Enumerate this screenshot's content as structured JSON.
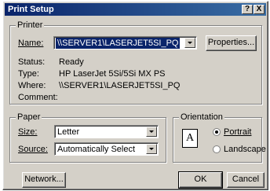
{
  "window": {
    "title": "Print Setup",
    "help_btn": "?",
    "close_btn": "X"
  },
  "printer": {
    "group_label": "Printer",
    "name_label": "Name:",
    "name_value": "\\\\SERVER1\\LASERJET5SI_PQ",
    "properties_button": "Properties...",
    "status_label": "Status:",
    "status_value": "Ready",
    "type_label": "Type:",
    "type_value": "HP LaserJet 5Si/5Si MX PS",
    "where_label": "Where:",
    "where_value": "\\\\SERVER1\\LASERJET5SI_PQ",
    "comment_label": "Comment:",
    "comment_value": ""
  },
  "paper": {
    "group_label": "Paper",
    "size_label": "Size:",
    "size_value": "Letter",
    "source_label": "Source:",
    "source_value": "Automatically Select"
  },
  "orientation": {
    "group_label": "Orientation",
    "page_icon_letter": "A",
    "portrait_label": "Portrait",
    "portrait_selected": true,
    "landscape_label": "Landscape",
    "landscape_selected": false
  },
  "buttons": {
    "network": "Network...",
    "ok": "OK",
    "cancel": "Cancel"
  }
}
